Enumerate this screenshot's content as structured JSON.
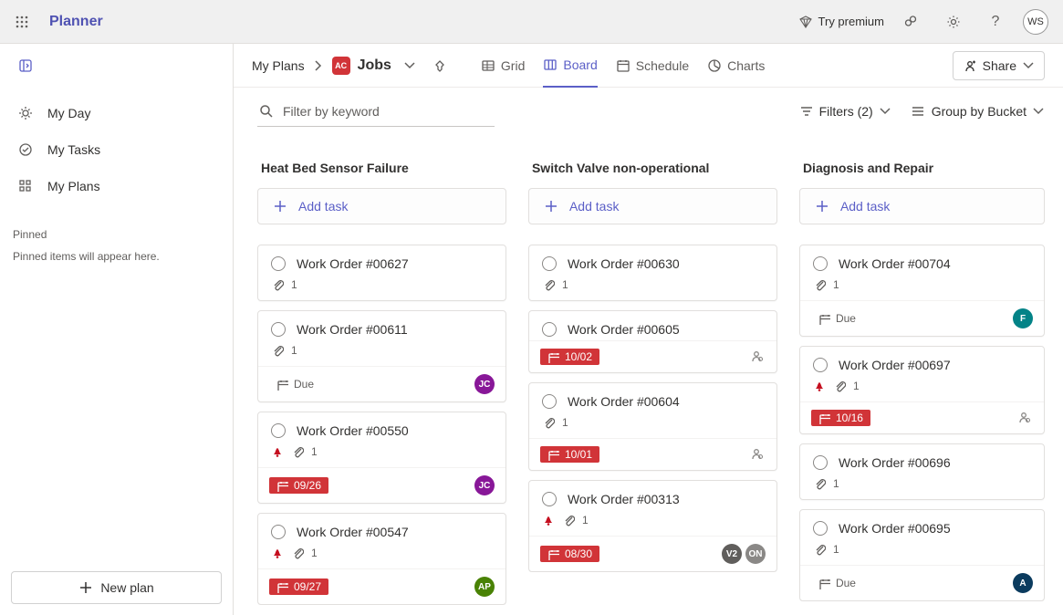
{
  "app": {
    "title": "Planner"
  },
  "header": {
    "try_premium": "Try premium",
    "avatar_initials": "WS"
  },
  "sidebar": {
    "my_day": "My Day",
    "my_tasks": "My Tasks",
    "my_plans": "My Plans",
    "pinned_header": "Pinned",
    "pinned_empty": "Pinned items will appear here.",
    "new_plan": "New plan"
  },
  "plan_header": {
    "breadcrumb_root": "My Plans",
    "plan_badge": "AC",
    "plan_name": "Jobs",
    "views": {
      "grid": "Grid",
      "board": "Board",
      "schedule": "Schedule",
      "charts": "Charts"
    },
    "share": "Share"
  },
  "filter_row": {
    "placeholder": "Filter by keyword",
    "filters_label": "Filters (2)",
    "group_by_label": "Group by Bucket"
  },
  "board": {
    "add_task_label": "Add task",
    "due_label": "Due",
    "buckets": [
      {
        "title": "Heat Bed Sensor Failure",
        "cards": [
          {
            "title": "Work Order #00627",
            "attachments": "1"
          },
          {
            "title": "Work Order #00611",
            "attachments": "1",
            "footer": {
              "due_text": "Due",
              "overdue": false,
              "assignees": [
                {
                  "initials": "JC",
                  "color": "#881798"
                }
              ]
            }
          },
          {
            "title": "Work Order #00550",
            "priority": true,
            "attachments": "1",
            "footer": {
              "due_text": "09/26",
              "overdue": true,
              "assignees": [
                {
                  "initials": "JC",
                  "color": "#881798"
                }
              ]
            }
          },
          {
            "title": "Work Order #00547",
            "priority": true,
            "attachments": "1",
            "footer": {
              "due_text": "09/27",
              "overdue": true,
              "assignees": [
                {
                  "initials": "AP",
                  "color": "#498205"
                }
              ]
            }
          }
        ]
      },
      {
        "title": "Switch Valve non-operational",
        "cards": [
          {
            "title": "Work Order #00630",
            "attachments": "1"
          },
          {
            "title": "Work Order #00605",
            "footer": {
              "due_text": "10/02",
              "overdue": true,
              "people_icon": true
            }
          },
          {
            "title": "Work Order #00604",
            "attachments": "1",
            "footer": {
              "due_text": "10/01",
              "overdue": true,
              "people_icon": true
            }
          },
          {
            "title": "Work Order #00313",
            "priority": true,
            "attachments": "1",
            "footer": {
              "due_text": "08/30",
              "overdue": true,
              "assignees": [
                {
                  "initials": "V2",
                  "color": "#605e5c"
                },
                {
                  "initials": "ON",
                  "color": "#8a8886"
                }
              ]
            }
          }
        ]
      },
      {
        "title": "Diagnosis and Repair",
        "cards": [
          {
            "title": "Work Order #00704",
            "attachments": "1",
            "footer": {
              "due_text": "Due",
              "overdue": false,
              "assignees": [
                {
                  "initials": "F",
                  "color": "#038387"
                }
              ]
            }
          },
          {
            "title": "Work Order #00697",
            "priority": true,
            "attachments": "1",
            "footer": {
              "due_text": "10/16",
              "overdue": true,
              "people_icon": true
            }
          },
          {
            "title": "Work Order #00696",
            "attachments": "1"
          },
          {
            "title": "Work Order #00695",
            "attachments": "1",
            "footer": {
              "due_text": "Due",
              "overdue": false,
              "assignees": [
                {
                  "initials": "A",
                  "color": "#0b3b5e"
                }
              ]
            }
          }
        ]
      }
    ]
  }
}
